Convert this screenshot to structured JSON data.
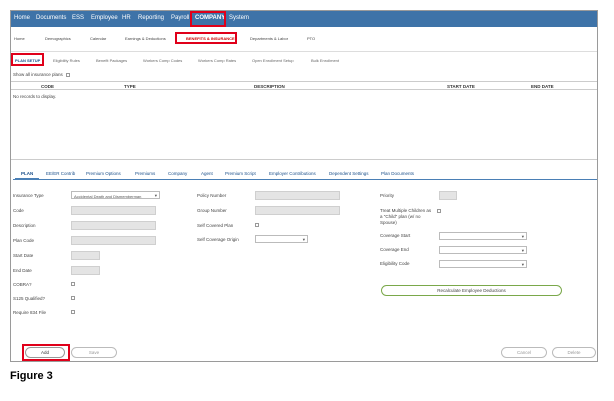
{
  "topnav": {
    "items": [
      "Home",
      "Documents",
      "ESS",
      "Employee",
      "HR",
      "Reporting",
      "Payroll",
      "COMPANY",
      "System"
    ]
  },
  "subnav": {
    "items": [
      "Home",
      "Demographics",
      "Calendar",
      "Earnings & Deductions",
      "BENEFITS & INSURANCE",
      "Departments & Labor",
      "PTO"
    ]
  },
  "thirdnav": {
    "items": [
      "PLAN SETUP",
      "Eligibility Rules",
      "Benefit Packages",
      "Workers Comp Codes",
      "Workers Comp Rates",
      "Open Enrollment Setup",
      "Bulk Enrollment"
    ]
  },
  "list": {
    "show_all_label": "Show all insurance plans",
    "columns": [
      "CODE",
      "TYPE",
      "DESCRIPTION",
      "START DATE",
      "END DATE"
    ],
    "empty_text": "No records to display."
  },
  "tabs": [
    "PLAN",
    "EE/ER Contrib",
    "Premium Options",
    "Premiums",
    "Company",
    "Agent",
    "Premium Script",
    "Employer Contributions",
    "Dependent Settings",
    "Plan Documents"
  ],
  "form": {
    "insurance_type_label": "Insurance Type",
    "insurance_type_value": "Accidental Death and Dismemberman",
    "code_label": "Code",
    "description_label": "Description",
    "plan_code_label": "Plan Code",
    "start_date_label": "Start Date",
    "end_date_label": "End Date",
    "cobra_label": "COBRA?",
    "s125_label": "S125 Qualified?",
    "require_1094_label": "Require 834 File",
    "policy_number_label": "Policy Number",
    "group_number_label": "Group Number",
    "self_covered_label": "Self Covered Plan",
    "self_coverage_origin_label": "Self Coverage Origin",
    "priority_label": "Priority",
    "treat_multiple_label_1": "Treat Multiple Children as",
    "treat_multiple_label_2": "a \"Child\" plan (w/ no",
    "treat_multiple_label_3": "Spouse)",
    "coverage_start_label": "Coverage Start",
    "coverage_end_label": "Coverage End",
    "eligibility_code_label": "Eligibility Code",
    "recalc_label": "Recalculate Employee Deductions"
  },
  "buttons": {
    "add": "Add",
    "save": "Save",
    "cancel": "Cancel",
    "delete": "Delete"
  },
  "caption": "Figure 3",
  "colors": {
    "nav_bg": "#3e73a8",
    "highlight": "#e0001a",
    "tab_accent": "#4a7fb5",
    "recalc_border": "#7aa84a"
  }
}
